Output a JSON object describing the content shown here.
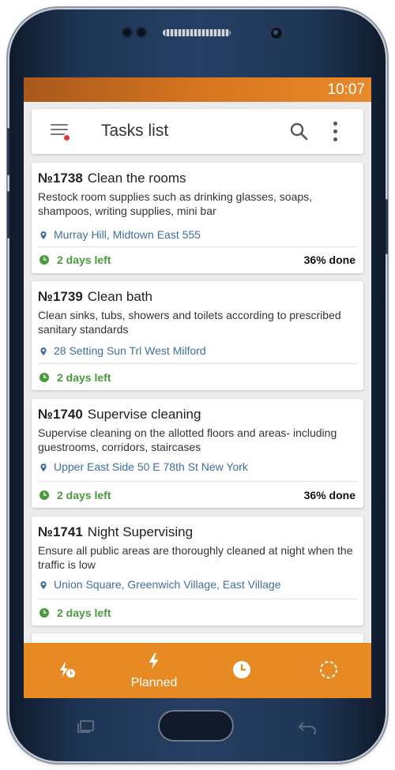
{
  "status_bar": {
    "time": "10:07"
  },
  "app_bar": {
    "title": "Tasks list",
    "menu_icon": "menu-notification-icon",
    "search_icon": "search-icon",
    "more_icon": "more-vert-icon"
  },
  "tasks": [
    {
      "number": "№1738",
      "title": "Clean the rooms",
      "description": "Restock room supplies such as drinking glasses, soaps, shampoos, writing supplies, mini bar",
      "location": "Murray Hill, Midtown East 555",
      "due": "2 days left",
      "progress": "36% done"
    },
    {
      "number": "№1739",
      "title": "Clean bath",
      "description": "Clean sinks, tubs, showers and toilets according to prescribed sanitary standards",
      "location": "28 Setting Sun Trl West Milford",
      "due": "2 days left",
      "progress": ""
    },
    {
      "number": "№1740",
      "title": "Supervise cleaning",
      "description": "Supervise cleaning on the allotted floors and areas- including guestrooms, corridors, staircases",
      "location": "Upper East Side 50 E 78th St New York",
      "due": "2 days left",
      "progress": "36% done"
    },
    {
      "number": "№1741",
      "title": "Night Supervising",
      "description": "Ensure all public areas are thoroughly cleaned at night when the traffic is low",
      "location": "Union Square, Greenwich Village, East Village",
      "due": "2 days left",
      "progress": ""
    }
  ],
  "bottom_nav": {
    "items": [
      {
        "icon": "flash-clock-icon",
        "label": ""
      },
      {
        "icon": "flash-icon",
        "label": "Planned"
      },
      {
        "icon": "clock-icon",
        "label": ""
      },
      {
        "icon": "circle-dashed-icon",
        "label": ""
      }
    ]
  },
  "colors": {
    "accent": "#E88A24",
    "status_bar": "#D9781F",
    "due_green": "#4B9A3E",
    "location_blue": "#3F6F9C"
  }
}
